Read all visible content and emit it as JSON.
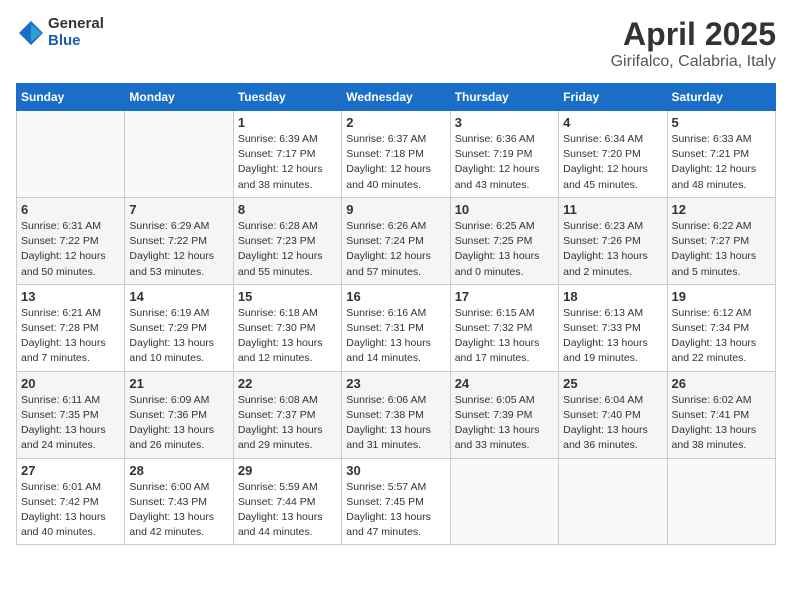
{
  "logo": {
    "general": "General",
    "blue": "Blue"
  },
  "title": "April 2025",
  "subtitle": "Girifalco, Calabria, Italy",
  "days_of_week": [
    "Sunday",
    "Monday",
    "Tuesday",
    "Wednesday",
    "Thursday",
    "Friday",
    "Saturday"
  ],
  "weeks": [
    [
      {
        "day": "",
        "sunrise": "",
        "sunset": "",
        "daylight": ""
      },
      {
        "day": "",
        "sunrise": "",
        "sunset": "",
        "daylight": ""
      },
      {
        "day": "1",
        "sunrise": "Sunrise: 6:39 AM",
        "sunset": "Sunset: 7:17 PM",
        "daylight": "Daylight: 12 hours and 38 minutes."
      },
      {
        "day": "2",
        "sunrise": "Sunrise: 6:37 AM",
        "sunset": "Sunset: 7:18 PM",
        "daylight": "Daylight: 12 hours and 40 minutes."
      },
      {
        "day": "3",
        "sunrise": "Sunrise: 6:36 AM",
        "sunset": "Sunset: 7:19 PM",
        "daylight": "Daylight: 12 hours and 43 minutes."
      },
      {
        "day": "4",
        "sunrise": "Sunrise: 6:34 AM",
        "sunset": "Sunset: 7:20 PM",
        "daylight": "Daylight: 12 hours and 45 minutes."
      },
      {
        "day": "5",
        "sunrise": "Sunrise: 6:33 AM",
        "sunset": "Sunset: 7:21 PM",
        "daylight": "Daylight: 12 hours and 48 minutes."
      }
    ],
    [
      {
        "day": "6",
        "sunrise": "Sunrise: 6:31 AM",
        "sunset": "Sunset: 7:22 PM",
        "daylight": "Daylight: 12 hours and 50 minutes."
      },
      {
        "day": "7",
        "sunrise": "Sunrise: 6:29 AM",
        "sunset": "Sunset: 7:22 PM",
        "daylight": "Daylight: 12 hours and 53 minutes."
      },
      {
        "day": "8",
        "sunrise": "Sunrise: 6:28 AM",
        "sunset": "Sunset: 7:23 PM",
        "daylight": "Daylight: 12 hours and 55 minutes."
      },
      {
        "day": "9",
        "sunrise": "Sunrise: 6:26 AM",
        "sunset": "Sunset: 7:24 PM",
        "daylight": "Daylight: 12 hours and 57 minutes."
      },
      {
        "day": "10",
        "sunrise": "Sunrise: 6:25 AM",
        "sunset": "Sunset: 7:25 PM",
        "daylight": "Daylight: 13 hours and 0 minutes."
      },
      {
        "day": "11",
        "sunrise": "Sunrise: 6:23 AM",
        "sunset": "Sunset: 7:26 PM",
        "daylight": "Daylight: 13 hours and 2 minutes."
      },
      {
        "day": "12",
        "sunrise": "Sunrise: 6:22 AM",
        "sunset": "Sunset: 7:27 PM",
        "daylight": "Daylight: 13 hours and 5 minutes."
      }
    ],
    [
      {
        "day": "13",
        "sunrise": "Sunrise: 6:21 AM",
        "sunset": "Sunset: 7:28 PM",
        "daylight": "Daylight: 13 hours and 7 minutes."
      },
      {
        "day": "14",
        "sunrise": "Sunrise: 6:19 AM",
        "sunset": "Sunset: 7:29 PM",
        "daylight": "Daylight: 13 hours and 10 minutes."
      },
      {
        "day": "15",
        "sunrise": "Sunrise: 6:18 AM",
        "sunset": "Sunset: 7:30 PM",
        "daylight": "Daylight: 13 hours and 12 minutes."
      },
      {
        "day": "16",
        "sunrise": "Sunrise: 6:16 AM",
        "sunset": "Sunset: 7:31 PM",
        "daylight": "Daylight: 13 hours and 14 minutes."
      },
      {
        "day": "17",
        "sunrise": "Sunrise: 6:15 AM",
        "sunset": "Sunset: 7:32 PM",
        "daylight": "Daylight: 13 hours and 17 minutes."
      },
      {
        "day": "18",
        "sunrise": "Sunrise: 6:13 AM",
        "sunset": "Sunset: 7:33 PM",
        "daylight": "Daylight: 13 hours and 19 minutes."
      },
      {
        "day": "19",
        "sunrise": "Sunrise: 6:12 AM",
        "sunset": "Sunset: 7:34 PM",
        "daylight": "Daylight: 13 hours and 22 minutes."
      }
    ],
    [
      {
        "day": "20",
        "sunrise": "Sunrise: 6:11 AM",
        "sunset": "Sunset: 7:35 PM",
        "daylight": "Daylight: 13 hours and 24 minutes."
      },
      {
        "day": "21",
        "sunrise": "Sunrise: 6:09 AM",
        "sunset": "Sunset: 7:36 PM",
        "daylight": "Daylight: 13 hours and 26 minutes."
      },
      {
        "day": "22",
        "sunrise": "Sunrise: 6:08 AM",
        "sunset": "Sunset: 7:37 PM",
        "daylight": "Daylight: 13 hours and 29 minutes."
      },
      {
        "day": "23",
        "sunrise": "Sunrise: 6:06 AM",
        "sunset": "Sunset: 7:38 PM",
        "daylight": "Daylight: 13 hours and 31 minutes."
      },
      {
        "day": "24",
        "sunrise": "Sunrise: 6:05 AM",
        "sunset": "Sunset: 7:39 PM",
        "daylight": "Daylight: 13 hours and 33 minutes."
      },
      {
        "day": "25",
        "sunrise": "Sunrise: 6:04 AM",
        "sunset": "Sunset: 7:40 PM",
        "daylight": "Daylight: 13 hours and 36 minutes."
      },
      {
        "day": "26",
        "sunrise": "Sunrise: 6:02 AM",
        "sunset": "Sunset: 7:41 PM",
        "daylight": "Daylight: 13 hours and 38 minutes."
      }
    ],
    [
      {
        "day": "27",
        "sunrise": "Sunrise: 6:01 AM",
        "sunset": "Sunset: 7:42 PM",
        "daylight": "Daylight: 13 hours and 40 minutes."
      },
      {
        "day": "28",
        "sunrise": "Sunrise: 6:00 AM",
        "sunset": "Sunset: 7:43 PM",
        "daylight": "Daylight: 13 hours and 42 minutes."
      },
      {
        "day": "29",
        "sunrise": "Sunrise: 5:59 AM",
        "sunset": "Sunset: 7:44 PM",
        "daylight": "Daylight: 13 hours and 44 minutes."
      },
      {
        "day": "30",
        "sunrise": "Sunrise: 5:57 AM",
        "sunset": "Sunset: 7:45 PM",
        "daylight": "Daylight: 13 hours and 47 minutes."
      },
      {
        "day": "",
        "sunrise": "",
        "sunset": "",
        "daylight": ""
      },
      {
        "day": "",
        "sunrise": "",
        "sunset": "",
        "daylight": ""
      },
      {
        "day": "",
        "sunrise": "",
        "sunset": "",
        "daylight": ""
      }
    ]
  ]
}
